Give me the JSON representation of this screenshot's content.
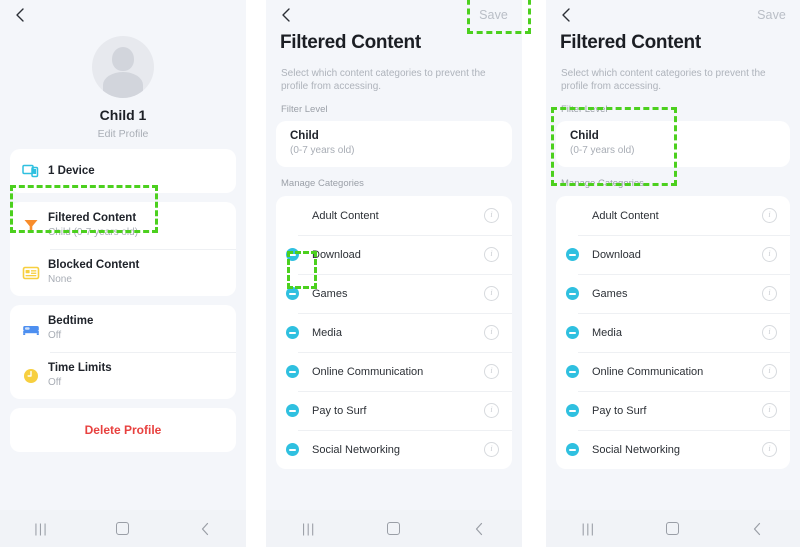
{
  "screens": {
    "profile": {
      "back_icon": "chevron-left-icon",
      "avatar": "default-avatar",
      "name": "Child 1",
      "edit_profile": "Edit Profile",
      "rows": [
        {
          "icon": "devices-icon",
          "title": "1 Device",
          "sub": ""
        },
        {
          "icon": "filter-funnel-icon",
          "title": "Filtered Content",
          "sub": "Child (0-7 years old)"
        },
        {
          "icon": "blocked-content-icon",
          "title": "Blocked Content",
          "sub": "None"
        },
        {
          "icon": "bed-icon",
          "title": "Bedtime",
          "sub": "Off"
        },
        {
          "icon": "clock-icon",
          "title": "Time Limits",
          "sub": "Off"
        }
      ],
      "delete_label": "Delete Profile"
    },
    "filtered": {
      "back_icon": "chevron-left-icon",
      "save_label": "Save",
      "title": "Filtered Content",
      "description": "Select which content categories to prevent the profile from accessing.",
      "filter_level_label": "Filter Level",
      "level_title": "Child",
      "level_sub": "(0-7 years old)",
      "manage_categories_label": "Manage Categories",
      "categories": [
        {
          "label": "Adult Content",
          "toggle": false,
          "info": "info-icon"
        },
        {
          "label": "Download",
          "toggle": true,
          "info": "info-icon"
        },
        {
          "label": "Games",
          "toggle": true,
          "info": "info-icon"
        },
        {
          "label": "Media",
          "toggle": true,
          "info": "info-icon"
        },
        {
          "label": "Online Communication",
          "toggle": true,
          "info": "info-icon"
        },
        {
          "label": "Pay to Surf",
          "toggle": true,
          "info": "info-icon"
        },
        {
          "label": "Social Networking",
          "toggle": true,
          "info": "info-icon"
        }
      ]
    }
  },
  "navbar": {
    "recents": "|||",
    "home": "home-square-icon",
    "back": "chevron-left-icon"
  },
  "annotations": {
    "filtered_content_box": "Filtered Content row highlight",
    "save_box": "Save button highlight",
    "download_box": "Download toggle highlight",
    "filter_level_box": "Filter Level section highlight"
  },
  "colors": {
    "screen_background": "#f4f6fa",
    "card_background": "#ffffff",
    "accent_cyan": "#2fc0e0",
    "accent_orange": "#f88c2b",
    "accent_yellow": "#f7cf3f",
    "accent_blue": "#4d8ff0",
    "delete_red": "#e8413f",
    "annotation_green": "#4cd01e",
    "title_text": "#1b1e24",
    "muted_text": "#a8adb5"
  }
}
